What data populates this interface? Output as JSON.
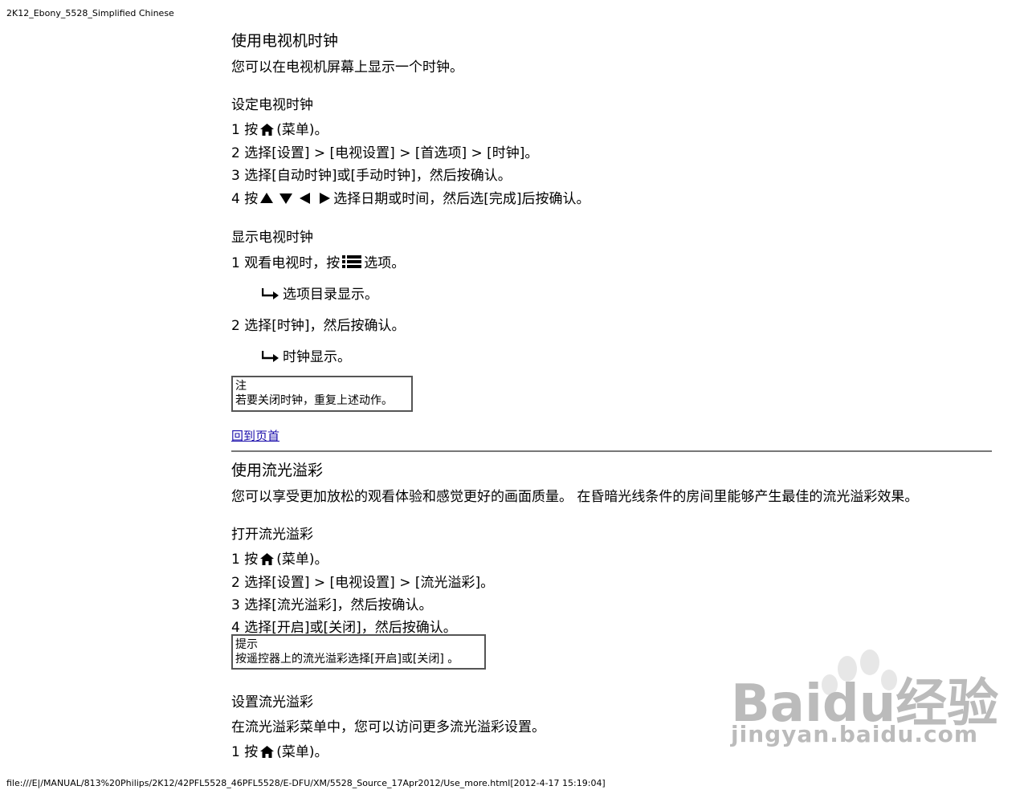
{
  "header_tag": "2K12_Ebony_5528_Simplified Chinese",
  "footer_path": "file:///E|/MANUAL/813%20Philips/2K12/42PFL5528_46PFL5528/E-DFU/XM/5528_Source_17Apr2012/Use_more.html[2012-4-17 15:19:04]",
  "clock": {
    "title": "使用电视机时钟",
    "intro": "您可以在电视机屏幕上显示一个时钟。",
    "set_title": "设定电视时钟",
    "set_step1_pre": "1 按",
    "set_step1_post": "(菜单)。",
    "set_step2": "2 选择[设置] > [电视设置] > [首选项] > [时钟]。",
    "set_step3": "3 选择[自动时钟]或[手动时钟]，然后按确认。",
    "set_step4_pre": "4 按",
    "set_step4_post": "选择日期或时间，然后选[完成]后按确认。",
    "show_title": "显示电视时钟",
    "show_step1_pre": "1 观看电视时，按",
    "show_step1_post": "选项。",
    "show_result1": "选项目录显示。",
    "show_step2": "2 选择[时钟]，然后按确认。",
    "show_result2": "时钟显示。",
    "note_label": "注",
    "note_text": "若要关闭时钟，重复上述动作。",
    "back_link": "回到页首"
  },
  "ambilight": {
    "title": "使用流光溢彩",
    "intro": "您可以享受更加放松的观看体验和感觉更好的画面质量。 在昏暗光线条件的房间里能够产生最佳的流光溢彩效果。",
    "on_title": "打开流光溢彩",
    "on_step1_pre": "1 按",
    "on_step1_post": "(菜单)。",
    "on_step2": "2 选择[设置] > [电视设置] > [流光溢彩]。",
    "on_step3": "3 选择[流光溢彩]，然后按确认。",
    "on_step4": "4 选择[开启]或[关闭]，然后按确认。",
    "tip_label": "提示",
    "tip_text": "按遥控器上的流光溢彩选择[开启]或[关闭] 。",
    "setup_title": "设置流光溢彩",
    "setup_intro": "在流光溢彩菜单中，您可以访问更多流光溢彩设置。",
    "setup_step1_pre": "1 按",
    "setup_step1_post": "(菜单)。"
  },
  "watermark": {
    "brand": "Baidu经验",
    "url": "jingyan.baidu.com"
  },
  "icons": {
    "home": "home-icon",
    "options": "options-list-icon",
    "nav": "navigation-arrows-icon",
    "result": "result-arrow-icon"
  }
}
